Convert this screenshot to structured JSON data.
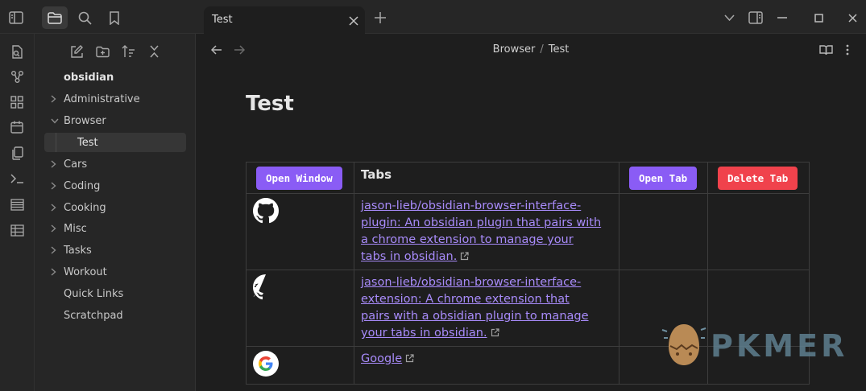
{
  "tab": {
    "label": "Test"
  },
  "breadcrumb": {
    "parent": "Browser",
    "separator": "/",
    "current": "Test"
  },
  "sidebar": {
    "vault_name": "obsidian",
    "items": [
      {
        "label": "Administrative",
        "type": "folder",
        "expanded": false
      },
      {
        "label": "Browser",
        "type": "folder",
        "expanded": true
      },
      {
        "label": "Test",
        "type": "file",
        "selected": true
      },
      {
        "label": "Cars",
        "type": "folder",
        "expanded": false
      },
      {
        "label": "Coding",
        "type": "folder",
        "expanded": false
      },
      {
        "label": "Cooking",
        "type": "folder",
        "expanded": false
      },
      {
        "label": "Misc",
        "type": "folder",
        "expanded": false
      },
      {
        "label": "Tasks",
        "type": "folder",
        "expanded": false
      },
      {
        "label": "Workout",
        "type": "folder",
        "expanded": false
      },
      {
        "label": "Quick Links",
        "type": "file"
      },
      {
        "label": "Scratchpad",
        "type": "file"
      }
    ]
  },
  "page": {
    "title": "Test",
    "table": {
      "open_window_label": "Open Window",
      "header_label": "Tabs",
      "open_tab_label": "Open Tab",
      "delete_tab_label": "Delete Tab",
      "rows": [
        {
          "icon": "github-icon",
          "lines": [
            "jason-lieb/obsidian-browser-interface-",
            "plugin: An obsidian plugin that pairs with",
            "a chrome extension to manage your",
            "tabs in obsidian."
          ]
        },
        {
          "icon": "github-icon",
          "lines": [
            "jason-lieb/obsidian-browser-interface-",
            "extension: A chrome extension that",
            "pairs with a obsidian plugin to manage",
            "your tabs in obsidian."
          ]
        },
        {
          "icon": "google-icon",
          "lines": [
            "Google"
          ]
        }
      ]
    }
  },
  "watermark": {
    "text": "PKMER"
  },
  "colors": {
    "accent": "#8a5cf5",
    "danger": "#f0424c",
    "link": "#a88bfa"
  }
}
